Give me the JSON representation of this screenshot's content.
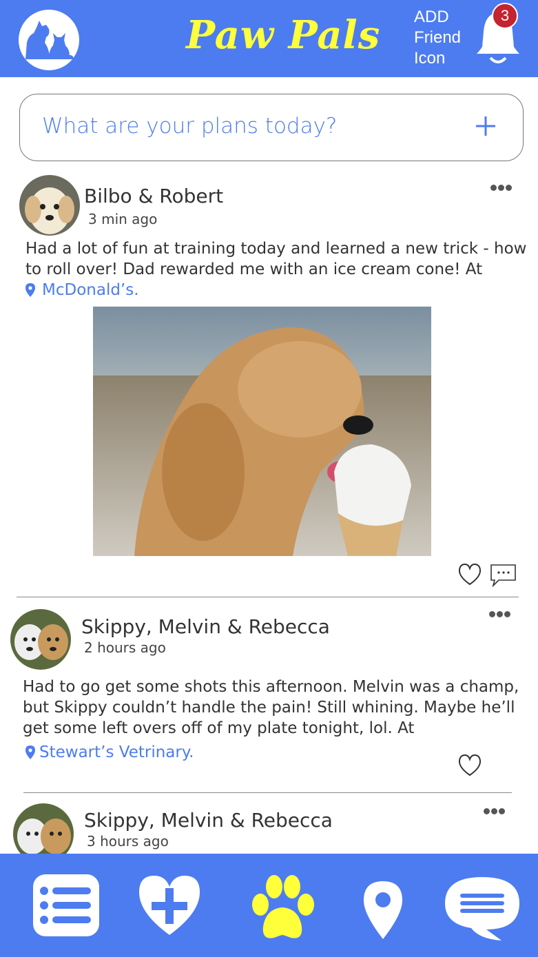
{
  "header": {
    "logo_icon": "dog-cat-logo-icon",
    "title": "Paw Pals",
    "add_friend_lines": [
      "ADD",
      "Friend",
      "Icon"
    ],
    "bell_icon": "bell-icon",
    "notification_count": "3",
    "title_color": "#ffff3a",
    "bar_color": "#4d7cf0"
  },
  "composer": {
    "placeholder": "What are your plans today?",
    "add_icon": "plus-icon"
  },
  "posts": [
    {
      "author": "Bilbo & Robert",
      "time": "3 min ago",
      "text_lines": [
        "Had a lot of fun at training today and learned a new trick - how",
        "to roll over! Dad rewarded me with an ice cream cone! At"
      ],
      "location": "McDonald’s.",
      "has_photo": true
    },
    {
      "author": "Skippy, Melvin & Rebecca",
      "time": "2 hours ago",
      "text_lines": [
        "Had to go get some shots this afternoon. Melvin was a champ,",
        "but Skippy couldn’t handle the pain! Still whining. Maybe he’ll",
        "get some left overs off of my plate tonight, lol. At"
      ],
      "location": "Stewart’s Vetrinary."
    },
    {
      "author": "Skippy, Melvin & Rebecca",
      "time": "3 hours ago"
    }
  ],
  "bottom_nav": {
    "items": [
      "list-icon",
      "heart-plus-icon",
      "paw-icon",
      "location-pin-icon",
      "chat-bubble-icon"
    ],
    "active": "paw-icon",
    "active_color": "#ffff3a"
  }
}
